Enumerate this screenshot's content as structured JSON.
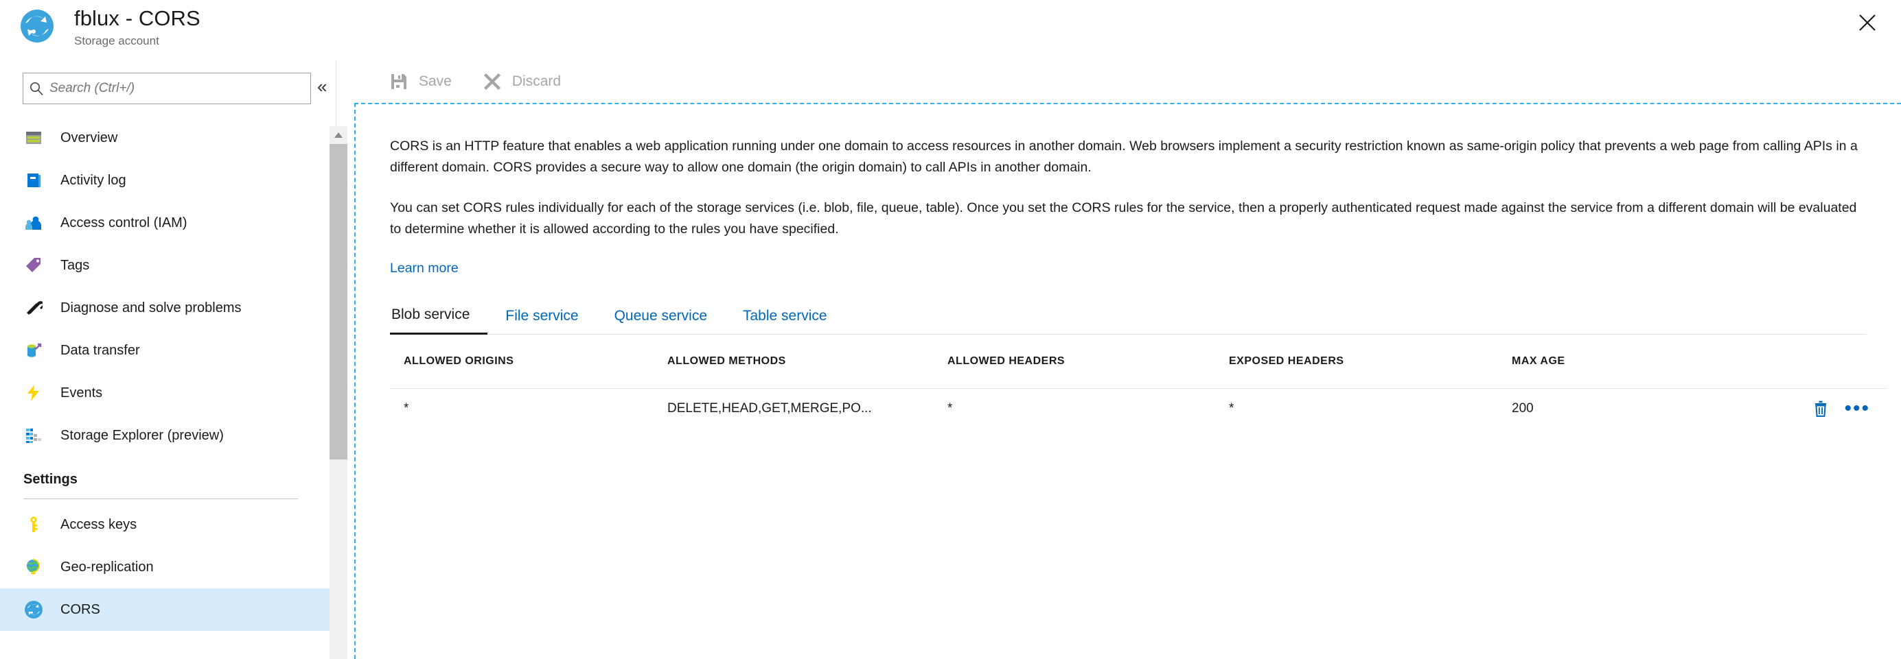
{
  "header": {
    "title": "fblux - CORS",
    "subtitle": "Storage account",
    "icon": "storage-account-icon",
    "close_label": "✕"
  },
  "sidebar": {
    "search": {
      "placeholder": "Search (Ctrl+/)",
      "value": "",
      "icon": "search-icon"
    },
    "collapse_label": "«",
    "items": [
      {
        "label": "Overview",
        "icon": "overview-icon",
        "selected": false
      },
      {
        "label": "Activity log",
        "icon": "activity-log-icon",
        "selected": false
      },
      {
        "label": "Access control (IAM)",
        "icon": "access-control-icon",
        "selected": false
      },
      {
        "label": "Tags",
        "icon": "tags-icon",
        "selected": false
      },
      {
        "label": "Diagnose and solve problems",
        "icon": "diagnose-icon",
        "selected": false
      },
      {
        "label": "Data transfer",
        "icon": "data-transfer-icon",
        "selected": false
      },
      {
        "label": "Events",
        "icon": "events-icon",
        "selected": false
      },
      {
        "label": "Storage Explorer (preview)",
        "icon": "storage-explorer-icon",
        "selected": false
      }
    ],
    "settings_section": {
      "title": "Settings",
      "items": [
        {
          "label": "Access keys",
          "icon": "key-icon",
          "selected": false
        },
        {
          "label": "Geo-replication",
          "icon": "globe-icon",
          "selected": false
        },
        {
          "label": "CORS",
          "icon": "cors-icon",
          "selected": true
        }
      ]
    }
  },
  "toolbar": {
    "save_label": "Save",
    "save_icon": "save-disk-icon",
    "discard_label": "Discard",
    "discard_icon": "discard-x-icon"
  },
  "main": {
    "paragraph1": "CORS is an HTTP feature that enables a web application running under one domain to access resources in another domain. Web browsers implement a security restriction known as same-origin policy that prevents a web page from calling APIs in a different domain. CORS provides a secure way to allow one domain (the origin domain) to call APIs in another domain.",
    "paragraph2": "You can set CORS rules individually for each of the storage services (i.e. blob, file, queue, table). Once you set the CORS rules for the service, then a properly authenticated request made against the service from a different domain will be evaluated to determine whether it is allowed according to the rules you have specified.",
    "learn_more": "Learn more",
    "tabs": [
      {
        "label": "Blob service",
        "active": true
      },
      {
        "label": "File service",
        "active": false
      },
      {
        "label": "Queue service",
        "active": false
      },
      {
        "label": "Table service",
        "active": false
      }
    ],
    "table": {
      "columns": [
        "ALLOWED ORIGINS",
        "ALLOWED METHODS",
        "ALLOWED HEADERS",
        "EXPOSED HEADERS",
        "MAX AGE"
      ],
      "rows": [
        {
          "allowed_origins": "*",
          "allowed_methods": "DELETE,HEAD,GET,MERGE,PO...",
          "allowed_headers": "*",
          "exposed_headers": "*",
          "max_age": "200",
          "delete_icon": "trash-icon",
          "more_icon": "ellipsis-icon",
          "more_label": "•••"
        }
      ]
    }
  },
  "colors": {
    "accent_blue": "#0067b8",
    "selected_row": "#d6ebfb",
    "focus_dash": "#31b0e8",
    "disabled_text": "#a6a6a6"
  }
}
